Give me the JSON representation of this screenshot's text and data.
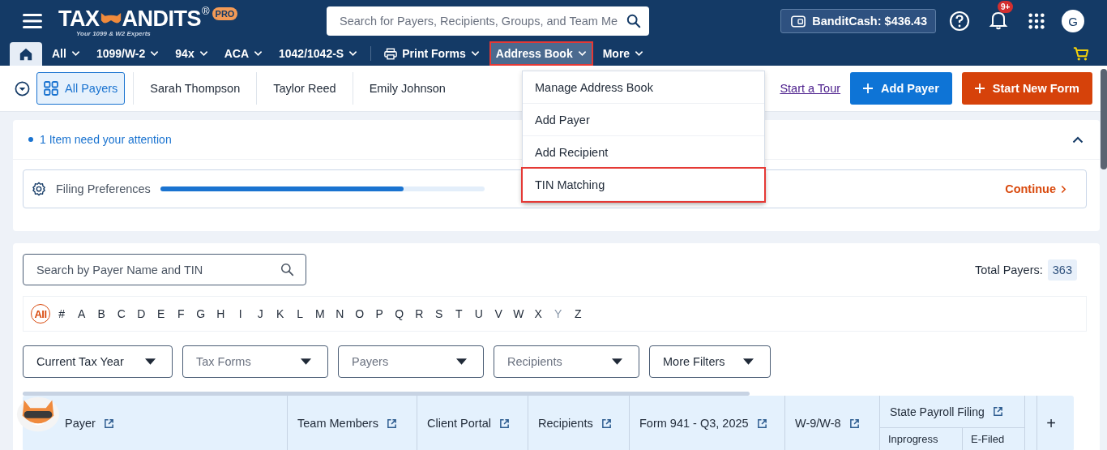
{
  "header": {
    "logo": {
      "left": "TAX",
      "right": "ANDITS",
      "mark": "®",
      "badge": "PRO",
      "tagline": "Your 1099 & W2 Experts"
    },
    "search": {
      "placeholder": "Search for Payers, Recipients, Groups, and Team Me"
    },
    "bandit_cash": "BanditCash: $436.43",
    "notifications_badge": "9+",
    "avatar": "G"
  },
  "nav": [
    {
      "kind": "home",
      "selected": false
    },
    {
      "kind": "menu",
      "label": "All",
      "selected": false
    },
    {
      "kind": "menu",
      "label": "1099/W-2",
      "selected": false
    },
    {
      "kind": "menu",
      "label": "94x",
      "selected": false
    },
    {
      "kind": "menu",
      "label": "ACA",
      "selected": false
    },
    {
      "kind": "menu",
      "label": "1042/1042-S",
      "selected": false
    },
    {
      "kind": "print",
      "label": "Print Forms",
      "selected": false
    },
    {
      "kind": "menu",
      "label": "Address Book",
      "selected": true
    },
    {
      "kind": "menu",
      "label": "More",
      "selected": false
    }
  ],
  "dropdown": [
    {
      "label": "Manage Address Book",
      "selected": false
    },
    {
      "label": "Add Payer",
      "selected": false
    },
    {
      "label": "Add Recipient",
      "selected": false
    },
    {
      "label": "TIN Matching",
      "selected": true
    }
  ],
  "payer_tabs": [
    {
      "label": "All Payers",
      "selected": true
    },
    {
      "label": "Sarah Thompson",
      "selected": false
    },
    {
      "label": "Taylor Reed",
      "selected": false
    },
    {
      "label": "Emily Johnson",
      "selected": false
    }
  ],
  "tour_link": "Start a Tour",
  "add_payer_button": "Add Payer",
  "start_form_button": "Start New Form",
  "attention": {
    "message": "1 Item need your attention",
    "expanded": true,
    "item": {
      "label": "Filing Preferences",
      "level": 0.75,
      "action": "Continue"
    }
  },
  "payers": {
    "search": {
      "placeholder": "Search by Payer Name and TIN"
    },
    "total_label": "Total Payers:",
    "total": "363",
    "letters": [
      {
        "label": "All",
        "selected": true,
        "disabled": false
      },
      {
        "label": "#",
        "selected": false,
        "disabled": false
      },
      {
        "label": "A",
        "selected": false,
        "disabled": false
      },
      {
        "label": "B",
        "selected": false,
        "disabled": false
      },
      {
        "label": "C",
        "selected": false,
        "disabled": false
      },
      {
        "label": "D",
        "selected": false,
        "disabled": false
      },
      {
        "label": "E",
        "selected": false,
        "disabled": false
      },
      {
        "label": "F",
        "selected": false,
        "disabled": false
      },
      {
        "label": "G",
        "selected": false,
        "disabled": false
      },
      {
        "label": "H",
        "selected": false,
        "disabled": false
      },
      {
        "label": "I",
        "selected": false,
        "disabled": false
      },
      {
        "label": "J",
        "selected": false,
        "disabled": false
      },
      {
        "label": "K",
        "selected": false,
        "disabled": false
      },
      {
        "label": "L",
        "selected": false,
        "disabled": false
      },
      {
        "label": "M",
        "selected": false,
        "disabled": false
      },
      {
        "label": "N",
        "selected": false,
        "disabled": false
      },
      {
        "label": "O",
        "selected": false,
        "disabled": false
      },
      {
        "label": "P",
        "selected": false,
        "disabled": false
      },
      {
        "label": "Q",
        "selected": false,
        "disabled": false
      },
      {
        "label": "R",
        "selected": false,
        "disabled": false
      },
      {
        "label": "S",
        "selected": false,
        "disabled": false
      },
      {
        "label": "T",
        "selected": false,
        "disabled": false
      },
      {
        "label": "U",
        "selected": false,
        "disabled": false
      },
      {
        "label": "V",
        "selected": false,
        "disabled": false
      },
      {
        "label": "W",
        "selected": false,
        "disabled": false
      },
      {
        "label": "X",
        "selected": false,
        "disabled": false
      },
      {
        "label": "Y",
        "selected": false,
        "disabled": true
      },
      {
        "label": "Z",
        "selected": false,
        "disabled": false
      }
    ],
    "filters": [
      {
        "label": "Current Tax Year",
        "kind": "value"
      },
      {
        "label": "Tax Forms",
        "kind": "placeholder"
      },
      {
        "label": "Payers",
        "kind": "placeholder"
      },
      {
        "label": "Recipients",
        "kind": "placeholder"
      },
      {
        "label": "More Filters",
        "kind": "value"
      }
    ],
    "table": {
      "columns": [
        {
          "label": "Payer"
        },
        {
          "label": "Team Members"
        },
        {
          "label": "Client Portal"
        },
        {
          "label": "Recipients"
        },
        {
          "label": "Form 941 - Q3, 2025"
        },
        {
          "label": "W-9/W-8"
        },
        {
          "label": "State Payroll Filing",
          "children": [
            {
              "label": "Inprogress"
            },
            {
              "label": "E-Filed"
            }
          ]
        }
      ],
      "add_column": "+"
    }
  }
}
